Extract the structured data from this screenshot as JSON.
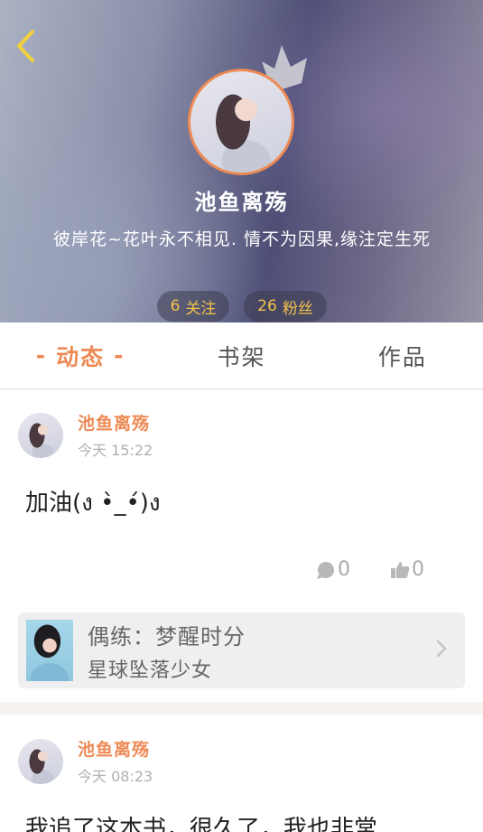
{
  "profile": {
    "nickname": "池鱼离殇",
    "signature": "彼岸花~花叶永不相见. 情不为因果,缘注定生死",
    "follow_count": "6",
    "follow_label": "关注",
    "fans_count": "26",
    "fans_label": "粉丝"
  },
  "tabs": [
    {
      "label": "动态",
      "active": true
    },
    {
      "label": "书架",
      "active": false
    },
    {
      "label": "作品",
      "active": false
    }
  ],
  "posts": [
    {
      "author": "池鱼离殇",
      "time": "今天 15:22",
      "text": "加油(ง •̀_•́)ง",
      "comments": "0",
      "likes": "0",
      "book": {
        "title": "偶练：梦醒时分",
        "author": "星球坠落少女"
      }
    },
    {
      "author": "池鱼离殇",
      "time": "今天 08:23",
      "text": "我追了这本书，很久了，我也非常"
    }
  ],
  "colors": {
    "accent": "#ee8a55",
    "gold": "#f3c14a",
    "back_arrow": "#f2d23c"
  }
}
